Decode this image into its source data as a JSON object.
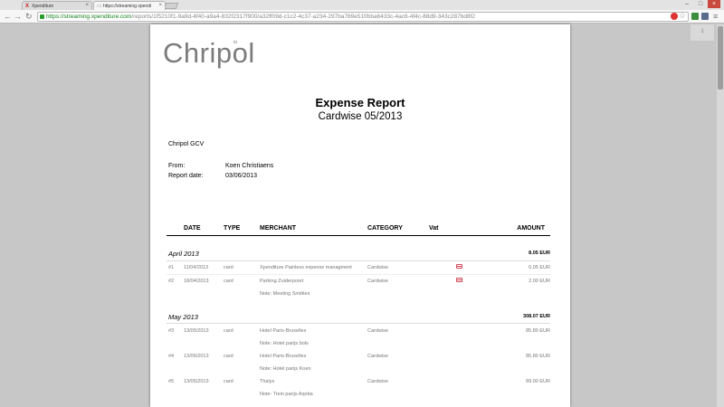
{
  "browser": {
    "tabs": [
      {
        "title": "Xpenditure",
        "favicon": "x-logo-icon"
      },
      {
        "title": "https://streaming.xpendi",
        "favicon": "document-icon"
      }
    ],
    "url_host": "https://streaming.xpenditure.com",
    "url_path": "/reports/1f5210f1-9a9d-4f40-a9a4-832f2317f900/a32ff09d-c1c2-4c37-a234-297ba769e51f/bba6433c-4ac6-4f4c-88d9-343c287bd8f2",
    "page_badge": "1"
  },
  "report": {
    "logo_text": "Chripol",
    "title": "Expense Report",
    "subtitle": "Cardwise 05/2013",
    "company": "Chripol GCV",
    "from_label": "From:",
    "from_value": "Koen Christiaens",
    "date_label": "Report date:",
    "date_value": "03/06/2013",
    "columns": [
      "DATE",
      "TYPE",
      "MERCHANT",
      "CATEGORY",
      "Vat",
      "AMOUNT"
    ]
  },
  "months": [
    {
      "name": "April 2013",
      "total": "8.05 EUR"
    },
    {
      "name": "May 2013",
      "total": "308.07 EUR"
    }
  ],
  "rows": [
    {
      "num": "#1",
      "date": "11/04/2013",
      "type": "card",
      "merchant": "Xpenditure Painless expense managment",
      "category": "Cardwise",
      "amount": "6.05 EUR",
      "card": true,
      "note": ""
    },
    {
      "num": "#2",
      "date": "18/04/2013",
      "type": "card",
      "merchant": "Parking Zuiderpoort",
      "category": "Cardwise",
      "amount": "2.00 EUR",
      "card": true,
      "note": "Note: Meeting Smitties"
    },
    {
      "num": "#3",
      "date": "13/05/2013",
      "type": "card",
      "merchant": "Hotel Paris-Bruxelles",
      "category": "Cardwise",
      "amount": "85.80 EUR",
      "card": false,
      "note": "Note: Hotel parijs bols"
    },
    {
      "num": "#4",
      "date": "13/05/2013",
      "type": "card",
      "merchant": "Hotel Paris-Bruxelles",
      "category": "Cardwise",
      "amount": "85.80 EUR",
      "card": false,
      "note": "Note: Hotel parijs Koen"
    },
    {
      "num": "#5",
      "date": "13/05/2013",
      "type": "card",
      "merchant": "Thalys",
      "category": "Cardwise",
      "amount": "89.00 EUR",
      "card": false,
      "note": "Note: Trein parijs Aqoba"
    }
  ],
  "colors": {
    "accent_green": "#17801c",
    "card_icon": "#d24a5a"
  }
}
